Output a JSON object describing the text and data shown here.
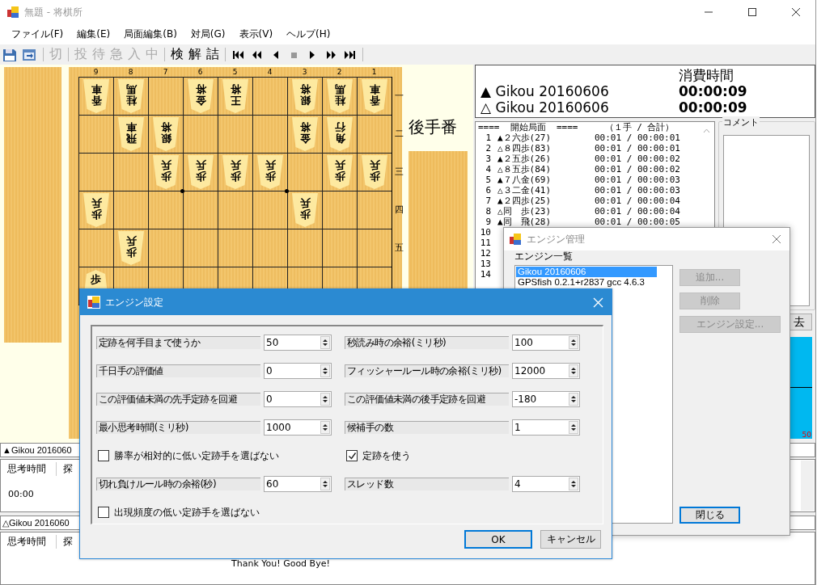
{
  "window": {
    "title": "無題 - 将棋所"
  },
  "menu": [
    "ファイル(F)",
    "編集(E)",
    "局面編集(B)",
    "対局(G)",
    "表示(V)",
    "ヘルプ(H)"
  ],
  "toolbar": {
    "text_groups": [
      [
        {
          "label": "切",
          "disabled": true
        }
      ],
      [
        {
          "label": "投",
          "disabled": true
        },
        {
          "label": "待",
          "disabled": true
        },
        {
          "label": "急",
          "disabled": true
        },
        {
          "label": "入",
          "disabled": true
        },
        {
          "label": "中",
          "disabled": true
        }
      ],
      [
        {
          "label": "検",
          "disabled": false
        },
        {
          "label": "解",
          "disabled": false
        },
        {
          "label": "詰",
          "disabled": false
        }
      ]
    ],
    "nav": [
      {
        "kind": "first",
        "disabled": false
      },
      {
        "kind": "back_many",
        "disabled": false
      },
      {
        "kind": "back",
        "disabled": false
      },
      {
        "kind": "stop",
        "disabled": true
      },
      {
        "kind": "forward",
        "disabled": false
      },
      {
        "kind": "forward_many",
        "disabled": false
      },
      {
        "kind": "last",
        "disabled": false
      }
    ]
  },
  "board": {
    "files": [
      "9",
      "8",
      "7",
      "6",
      "5",
      "4",
      "3",
      "2",
      "1"
    ],
    "ranks": [
      "一",
      "二",
      "三",
      "四",
      "五"
    ],
    "rows": [
      [
        {
          "piece": "香車",
          "reversed": true
        },
        {
          "piece": "桂馬",
          "reversed": true
        },
        {},
        {
          "piece": "金将",
          "reversed": true
        },
        {
          "piece": "王将",
          "reversed": true
        },
        {},
        {
          "piece": "銀将",
          "reversed": true
        },
        {
          "piece": "桂馬",
          "reversed": true
        },
        {
          "piece": "香車",
          "reversed": true
        }
      ],
      [
        {},
        {
          "piece": "飛車",
          "reversed": true
        },
        {
          "piece": "銀将",
          "reversed": true
        },
        {},
        {},
        {},
        {
          "piece": "金将",
          "reversed": true
        },
        {
          "piece": "角行",
          "reversed": true
        },
        {}
      ],
      [
        {},
        {},
        {
          "piece": "歩兵",
          "reversed": true
        },
        {
          "piece": "歩兵",
          "reversed": true
        },
        {
          "piece": "歩兵",
          "reversed": true
        },
        {
          "piece": "歩兵",
          "reversed": true
        },
        {},
        {
          "piece": "歩兵",
          "reversed": true
        },
        {
          "piece": "歩兵",
          "reversed": true
        }
      ],
      [
        {
          "piece": "歩兵",
          "reversed": true
        },
        {},
        {},
        {},
        {},
        {},
        {
          "piece": "歩兵",
          "reversed": true
        },
        {},
        {}
      ],
      [
        {},
        {
          "piece": "歩兵",
          "reversed": true
        },
        {},
        {},
        {},
        {},
        {},
        {},
        {}
      ],
      [
        {
          "piece": "歩",
          "reversed": false
        },
        {},
        {},
        {},
        {},
        {},
        {},
        {},
        {}
      ]
    ],
    "turn": "後手番"
  },
  "players": {
    "heading": "消費時間",
    "rows": [
      {
        "name": "▲ Gikou 20160606",
        "time": "00:00:09"
      },
      {
        "name": "△ Gikou 20160606",
        "time": "00:00:09"
      }
    ]
  },
  "kifu": {
    "header": "====  開始局面  ====     （１手 / 合計）",
    "lines": [
      {
        "num": "1",
        "move": "▲２六歩(27)",
        "time": "00:01 / 00:00:01"
      },
      {
        "num": "2",
        "move": "△８四歩(83)",
        "time": "00:01 / 00:00:01"
      },
      {
        "num": "3",
        "move": "▲２五歩(26)",
        "time": "00:01 / 00:00:02"
      },
      {
        "num": "4",
        "move": "△８五歩(84)",
        "time": "00:01 / 00:00:02"
      },
      {
        "num": "5",
        "move": "▲７八金(69)",
        "time": "00:01 / 00:00:03"
      },
      {
        "num": "6",
        "move": "△３二金(41)",
        "time": "00:01 / 00:00:03"
      },
      {
        "num": "7",
        "move": "▲２四歩(25)",
        "time": "00:01 / 00:00:04"
      },
      {
        "num": "8",
        "move": "△同　歩(23)",
        "time": "00:01 / 00:00:04"
      },
      {
        "num": "9",
        "move": "▲同　飛(28)",
        "time": "00:01 / 00:00:05"
      },
      {
        "num": "10"
      },
      {
        "num": "11"
      },
      {
        "num": "12"
      },
      {
        "num": "13"
      },
      {
        "num": "14"
      }
    ]
  },
  "comment": {
    "label": "コメント",
    "button": "去"
  },
  "graph": {
    "axis_label": "50"
  },
  "engine_panels": [
    {
      "name": "▲Gikou 2016060",
      "columns": [
        "思考時間",
        "探"
      ],
      "time": "00:00"
    },
    {
      "name": "△Gikou 2016060",
      "columns": [
        "思考時間",
        "探"
      ],
      "log": "Thank You! Good Bye!"
    }
  ],
  "engine_manager": {
    "title": "エンジン管理",
    "list_label": "エンジン一覧",
    "engines": [
      {
        "name": "Gikou 20160606",
        "selected": true
      },
      {
        "name": "GPSfish 0.2.1+r2837 gcc 4.6.3",
        "selected": false
      }
    ],
    "buttons": [
      {
        "label": "追加...",
        "disabled": true,
        "default": false
      },
      {
        "label": "削除",
        "disabled": true,
        "default": false
      },
      {
        "label": "エンジン設定...",
        "disabled": true,
        "default": false
      }
    ],
    "close_button": {
      "label": "閉じる",
      "disabled": false,
      "default": true
    }
  },
  "engine_settings": {
    "title": "エンジン設定",
    "items": [
      {
        "kind": "spin",
        "label": "定跡を何手目まで使うか",
        "value": "50"
      },
      {
        "kind": "spin",
        "label": "秒読み時の余裕(ミリ秒)",
        "value": "100"
      },
      {
        "kind": "spin",
        "label": "千日手の評価値",
        "value": "0"
      },
      {
        "kind": "spin",
        "label": "フィッシャールール時の余裕(ミリ秒)",
        "value": "12000"
      },
      {
        "kind": "spin",
        "label": "この評価値未満の先手定跡を回避",
        "value": "0"
      },
      {
        "kind": "spin",
        "label": "この評価値未満の後手定跡を回避",
        "value": "-180"
      },
      {
        "kind": "spin",
        "label": "最小思考時間(ミリ秒)",
        "value": "1000"
      },
      {
        "kind": "spin",
        "label": "候補手の数",
        "value": "1"
      },
      {
        "kind": "check",
        "label": "勝率が相対的に低い定跡手を選ばない",
        "checked": false
      },
      {
        "kind": "check",
        "label": "定跡を使う",
        "checked": true
      },
      {
        "kind": "spin",
        "label": "切れ負けルール時の余裕(秒)",
        "value": "60"
      },
      {
        "kind": "spin",
        "label": "スレッド数",
        "value": "4"
      },
      {
        "kind": "check",
        "label": "出現頻度の低い定跡手を選ばない",
        "checked": false
      }
    ],
    "buttons": [
      {
        "label": "OK",
        "default": true
      },
      {
        "label": "キャンセル",
        "default": false
      }
    ]
  }
}
